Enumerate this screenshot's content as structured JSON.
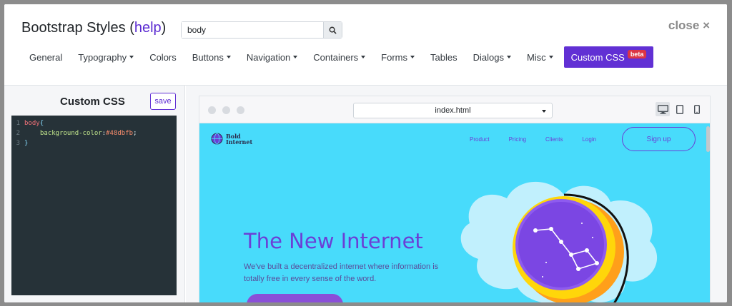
{
  "header": {
    "title": "Bootstrap Styles",
    "help_open": "(",
    "help_label": "help",
    "help_close": ")",
    "close_label": "close ×"
  },
  "search": {
    "value": "body",
    "placeholder": ""
  },
  "nav": {
    "items": [
      {
        "label": "General",
        "dropdown": false
      },
      {
        "label": "Typography",
        "dropdown": true
      },
      {
        "label": "Colors",
        "dropdown": false
      },
      {
        "label": "Buttons",
        "dropdown": true
      },
      {
        "label": "Navigation",
        "dropdown": true
      },
      {
        "label": "Containers",
        "dropdown": true
      },
      {
        "label": "Forms",
        "dropdown": true
      },
      {
        "label": "Tables",
        "dropdown": false
      },
      {
        "label": "Dialogs",
        "dropdown": true
      },
      {
        "label": "Misc",
        "dropdown": true
      }
    ],
    "active_label": "Custom CSS",
    "active_badge": "beta"
  },
  "editor_panel": {
    "title": "Custom CSS",
    "save_label": "save",
    "lines": [
      {
        "no": "1",
        "selector": "body",
        "open": " {"
      },
      {
        "no": "2",
        "prop": "background-color",
        "colon": ": ",
        "value": "#48dbfb",
        "semi": ";"
      },
      {
        "no": "3",
        "close": "}"
      }
    ]
  },
  "preview": {
    "page_select": "index.html",
    "devices": [
      "desktop-icon",
      "tablet-icon",
      "mobile-icon"
    ],
    "site": {
      "logo_line1": "Bold",
      "logo_line2": "Internet",
      "links": [
        "Product",
        "Pricing",
        "Clients",
        "Login"
      ],
      "signup": "Sign up",
      "hero_title": "The New Internet",
      "hero_sub": "We've built a decentralized internet where information is totally free in every sense of the word."
    }
  },
  "colors": {
    "accent": "#6130d4",
    "badge": "#dc3545",
    "site_bg": "#48dbfb",
    "editor_bg": "#263238"
  }
}
